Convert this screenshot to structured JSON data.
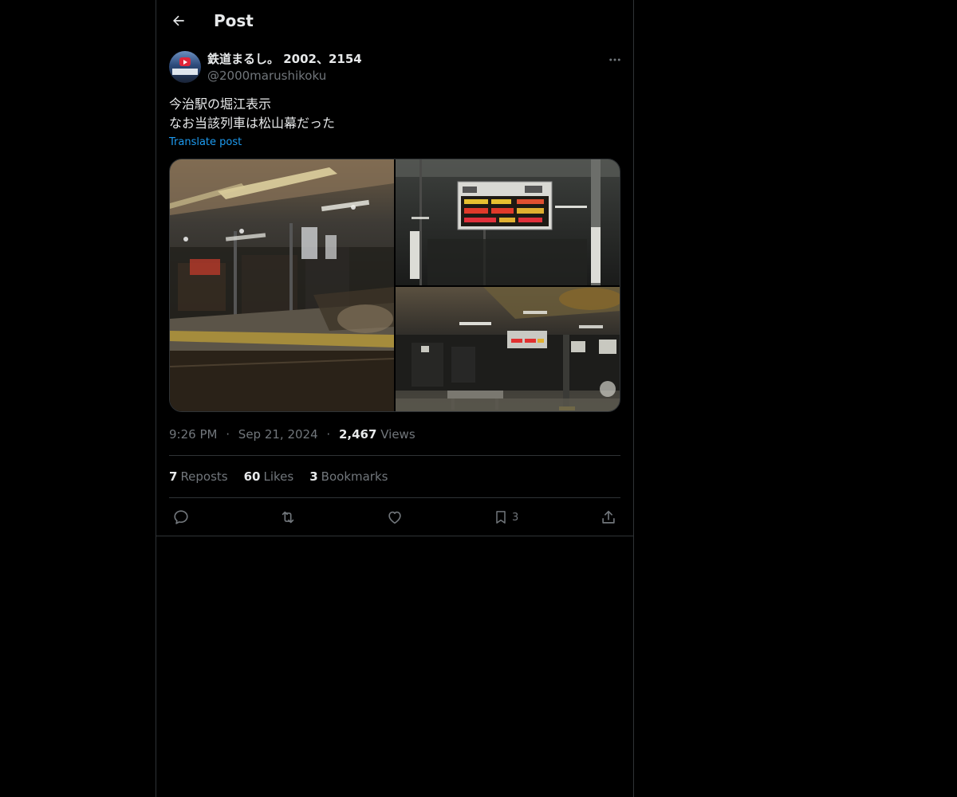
{
  "header": {
    "title": "Post",
    "back_icon": "arrow-left-icon"
  },
  "author": {
    "display_name": "鉄道まるし。 2002、2154",
    "handle": "@2000marushikoku",
    "more_icon": "more-horizontal-icon"
  },
  "post": {
    "lines": [
      "今治駅の堀江表示",
      "なお当該列車は松山幕だった"
    ],
    "translate_label": "Translate post"
  },
  "meta": {
    "time": "9:26 PM",
    "separator": "·",
    "date": "Sep 21, 2024",
    "views_count": "2,467",
    "views_label": "Views"
  },
  "stats": {
    "reposts_count": "7",
    "reposts_label": "Reposts",
    "likes_count": "60",
    "likes_label": "Likes",
    "bookmarks_count": "3",
    "bookmarks_label": "Bookmarks"
  },
  "actions": {
    "reply_icon": "reply-icon",
    "repost_icon": "repost-icon",
    "like_icon": "heart-icon",
    "bookmark_icon": "bookmark-icon",
    "bookmark_count": "3",
    "share_icon": "share-icon"
  },
  "colors": {
    "background": "#000000",
    "text": "#e7e9ea",
    "muted": "#71767b",
    "link": "#1d9bf0",
    "border": "#2f3336"
  }
}
